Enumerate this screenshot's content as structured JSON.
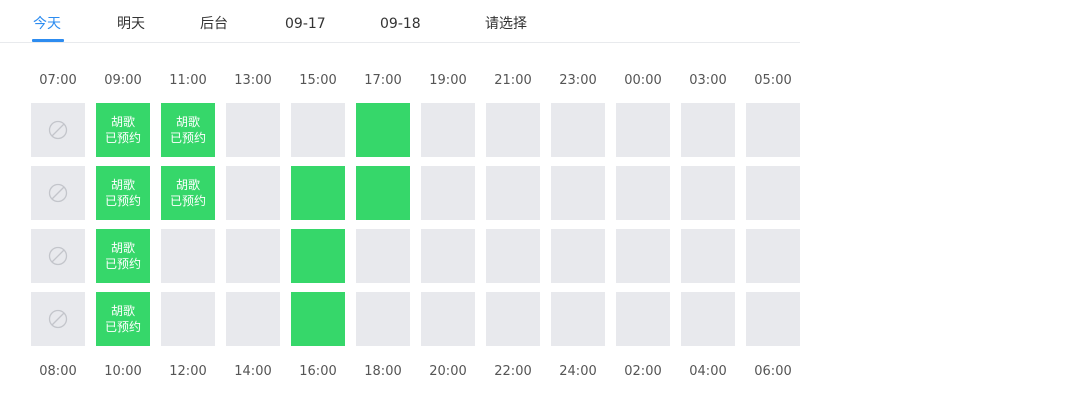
{
  "tabs": [
    {
      "label": "今天",
      "active": true
    },
    {
      "label": "明天",
      "active": false
    },
    {
      "label": "后台",
      "active": false
    },
    {
      "label": "09-17",
      "active": false
    },
    {
      "label": "09-18",
      "active": false
    },
    {
      "label": "请选择",
      "active": false
    }
  ],
  "start_times": [
    "07:00",
    "09:00",
    "11:00",
    "13:00",
    "15:00",
    "17:00",
    "19:00",
    "21:00",
    "23:00",
    "00:00",
    "03:00",
    "05:00"
  ],
  "end_times": [
    "08:00",
    "10:00",
    "12:00",
    "14:00",
    "16:00",
    "18:00",
    "20:00",
    "22:00",
    "24:00",
    "02:00",
    "04:00",
    "06:00"
  ],
  "colors": {
    "accent": "#2d8cf0",
    "empty_slot": "#e8e9ed",
    "booked_slot": "#36d76a",
    "selected_slot": "#36d76a"
  },
  "booking_name": "胡歌",
  "booking_status": "已预约",
  "rows": [
    [
      "disabled",
      "booked",
      "booked",
      "empty",
      "empty",
      "selected",
      "empty",
      "empty",
      "empty",
      "empty",
      "empty",
      "empty"
    ],
    [
      "disabled",
      "booked",
      "booked",
      "empty",
      "selected",
      "selected",
      "empty",
      "empty",
      "empty",
      "empty",
      "empty",
      "empty"
    ],
    [
      "disabled",
      "booked",
      "empty",
      "empty",
      "selected",
      "empty",
      "empty",
      "empty",
      "empty",
      "empty",
      "empty",
      "empty"
    ],
    [
      "disabled",
      "booked",
      "empty",
      "empty",
      "selected",
      "empty",
      "empty",
      "empty",
      "empty",
      "empty",
      "empty",
      "empty"
    ]
  ]
}
